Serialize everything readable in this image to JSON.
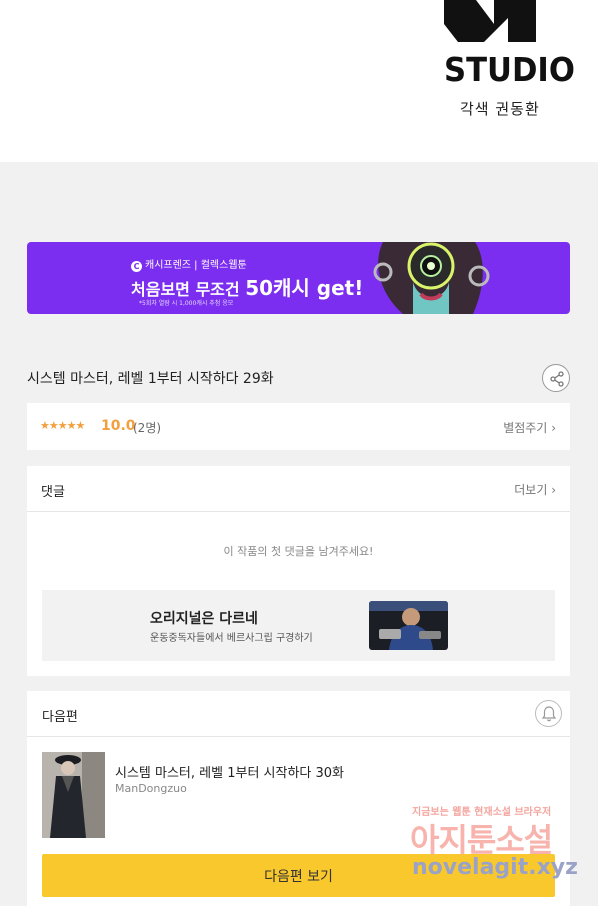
{
  "header": {
    "studio_logo_text": "STUDIO",
    "credit": "각색 권동환"
  },
  "banner": {
    "brand": "캐시프렌즈 | 컬렉스웹툰",
    "headline_prefix": "처음보면 무조건 ",
    "headline_big": "50캐시 get!!",
    "fine_print": "*5회차 열람 시 1,000캐시 추첨 응모"
  },
  "episode": {
    "title": "시스템 마스터, 레벨 1부터 시작하다 29화"
  },
  "rating": {
    "stars": "★★★★★",
    "score": "10.0",
    "count": "(2명)",
    "rate_link": "별점주기"
  },
  "comments": {
    "title": "댓글",
    "more_link": "더보기",
    "empty_message": "이 작품의 첫 댓글을 남겨주세요!",
    "promo": {
      "title": "오리지널은 다르네",
      "subtitle": "운동중독자들에서 베르사그립 구경하기"
    }
  },
  "next": {
    "title": "다음편",
    "episode_title": "시스템 마스터, 레벨 1부터 시작하다 30화",
    "author": "ManDongzuo",
    "button_label": "다음편 보기"
  },
  "watermark": {
    "top_line": "지금보는 웹툰 현재소설 브라우저",
    "main": "아지툰소설",
    "url": "novelagit.xyz"
  },
  "colors": {
    "banner_bg": "#7b2ef0",
    "star": "#f2a03d",
    "next_button": "#f9c82d"
  },
  "icons": {
    "share": "share-icon",
    "bell": "bell-icon",
    "chevron": "chevron-right-icon"
  }
}
